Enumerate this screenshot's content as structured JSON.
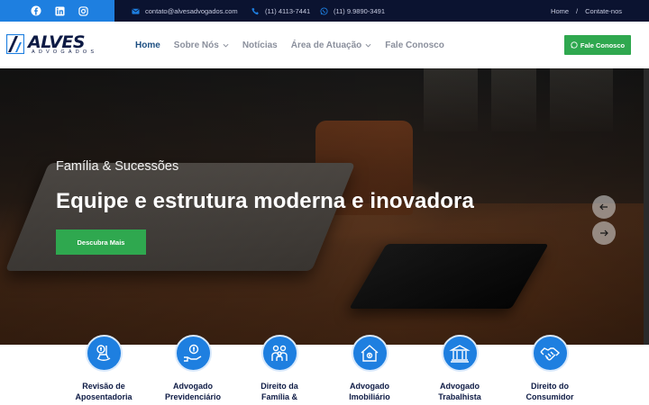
{
  "topbar": {
    "email": "contato@alvesadvogados.com",
    "phone": "(11) 4113-7441",
    "whatsapp": "(11) 9.9890-3491",
    "links": [
      "Home",
      "/",
      "Contate-nos"
    ]
  },
  "logo": {
    "name": "ALVES",
    "subtitle": "ADVOGADOS"
  },
  "nav": {
    "items": [
      {
        "label": "Home",
        "active": true
      },
      {
        "label": "Sobre Nós",
        "dropdown": true
      },
      {
        "label": "Notícias"
      },
      {
        "label": "Área de Atuação",
        "dropdown": true
      },
      {
        "label": "Fale Conosco"
      }
    ],
    "cta_label": "Fale Conosco"
  },
  "hero": {
    "kicker": "Família & Sucessões",
    "title": "Equipe e estrutura moderna e inovadora",
    "button_label": "Descubra Mais"
  },
  "services": [
    {
      "line1": "Revisão de",
      "line2": "Aposentadoria",
      "icon": "money-rocking-chair-icon"
    },
    {
      "line1": "Advogado",
      "line2": "Previdenciário",
      "icon": "money-hand-icon"
    },
    {
      "line1": "Direito da",
      "line2": "Família &",
      "icon": "family-icon"
    },
    {
      "line1": "Advogado",
      "line2": "Imobiliário",
      "icon": "house-icon"
    },
    {
      "line1": "Advogado",
      "line2": "Trabalhista",
      "icon": "courthouse-icon"
    },
    {
      "line1": "Direito do",
      "line2": "Consumidor",
      "icon": "handshake-icon"
    }
  ],
  "colors": {
    "topbar": "#0b1330",
    "accent_blue": "#1e7fe0",
    "accent_green": "#2fa84f",
    "navy": "#0d1a44"
  }
}
